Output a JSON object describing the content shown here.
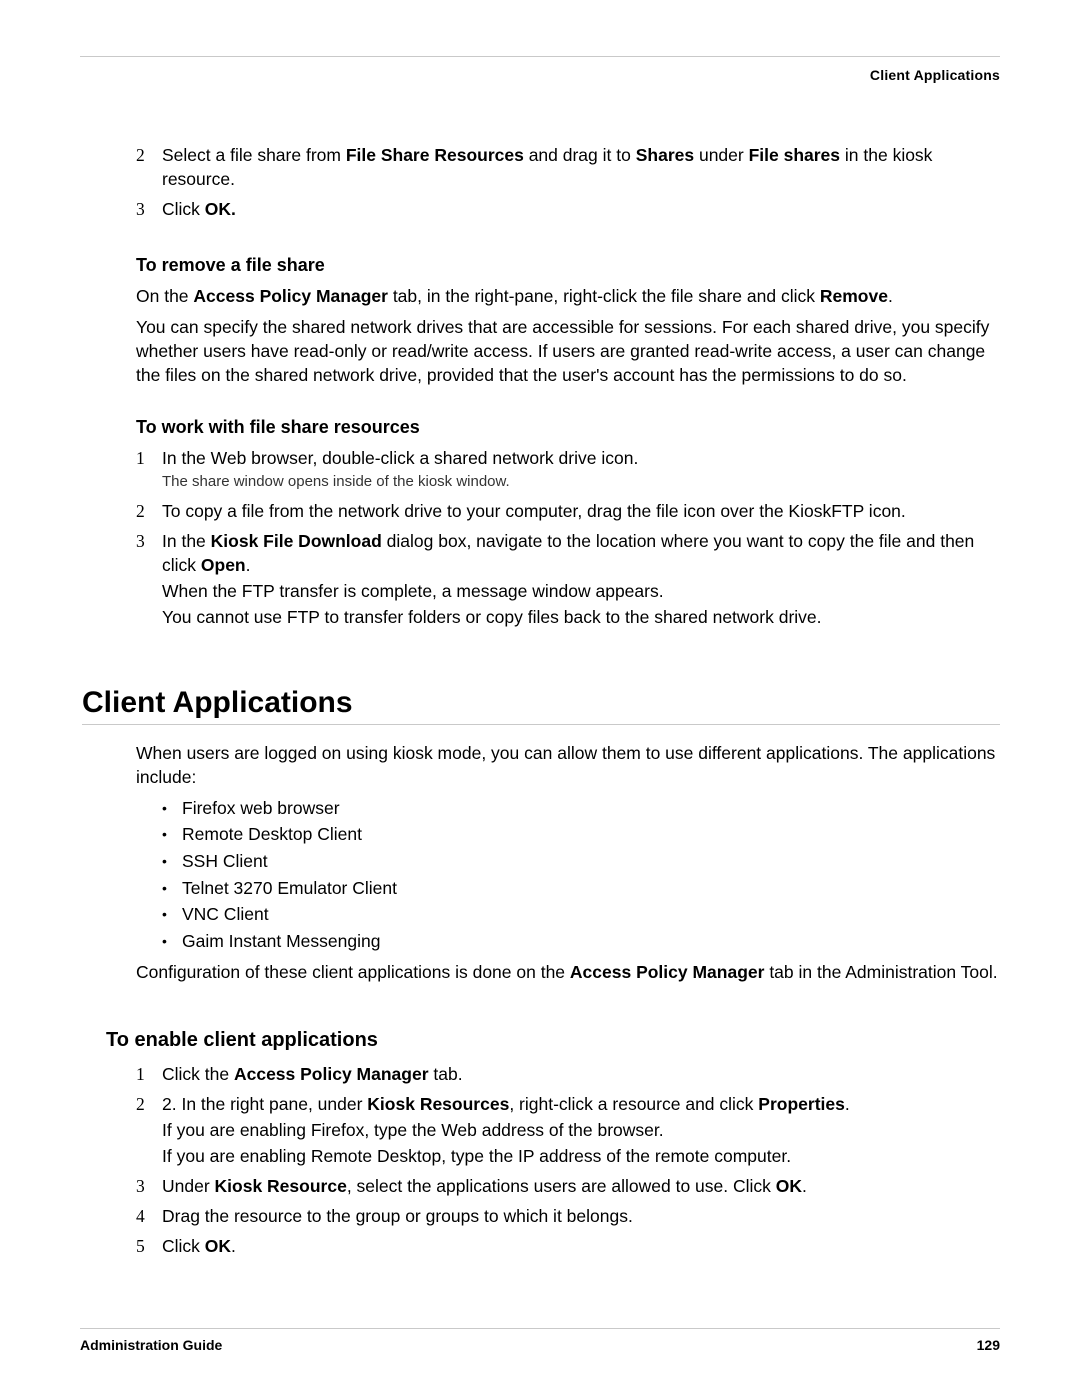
{
  "header": {
    "running": "Client Applications"
  },
  "footer": {
    "left": "Administration Guide",
    "right": "129"
  },
  "top_steps": [
    {
      "n": "2",
      "runs": [
        {
          "t": "Select a file share from "
        },
        {
          "t": "File Share Resources",
          "b": true
        },
        {
          "t": " and drag it to "
        },
        {
          "t": "Shares",
          "b": true
        },
        {
          "t": " under "
        },
        {
          "t": "File shares",
          "b": true
        },
        {
          "t": " in the kiosk resource."
        }
      ]
    },
    {
      "n": "3",
      "runs": [
        {
          "t": "Click "
        },
        {
          "t": "OK.",
          "b": true
        }
      ]
    }
  ],
  "remove_heading": "To remove a file share",
  "remove_p1_runs": [
    {
      "t": "On the "
    },
    {
      "t": "Access Policy Manager",
      "b": true
    },
    {
      "t": " tab, in the right-pane, right-click the file share and click "
    },
    {
      "t": "Remove",
      "b": true
    },
    {
      "t": "."
    }
  ],
  "remove_p2": "You can specify the shared network drives that are accessible for sessions. For each shared drive, you specify whether users have read-only or read/write access. If users are granted read-write access, a user can change the files on the shared network drive, provided that the user's account has the permissions to do so.",
  "work_heading": "To work with file share resources",
  "work_steps": [
    {
      "n": "1",
      "runs": [
        {
          "t": "In the Web browser, double-click a shared network drive icon."
        }
      ],
      "note": "The share window opens inside of the kiosk window."
    },
    {
      "n": "2",
      "runs": [
        {
          "t": "To copy a file from the network drive to your computer, drag the file icon over the KioskFTP icon."
        }
      ]
    },
    {
      "n": "3",
      "runs": [
        {
          "t": "In the "
        },
        {
          "t": "Kiosk File Download",
          "b": true
        },
        {
          "t": " dialog box, navigate to the location where you want to copy the file and then click "
        },
        {
          "t": "Open",
          "b": true
        },
        {
          "t": "."
        }
      ],
      "follow": [
        "When the FTP transfer is complete, a message window appears.",
        "You cannot use FTP to transfer folders or copy files back to the shared network drive."
      ]
    }
  ],
  "section_title": "Client Applications",
  "apps_intro": "When users are logged on using kiosk mode, you can allow them to use different applications. The applications include:",
  "apps_list": [
    "Firefox web browser",
    "Remote Desktop Client",
    "SSH Client",
    "Telnet 3270 Emulator Client",
    "VNC Client",
    "Gaim Instant Messenging"
  ],
  "apps_outro_runs": [
    {
      "t": "Configuration of these client applications is done on the "
    },
    {
      "t": "Access Policy Manager",
      "b": true
    },
    {
      "t": " tab in the Administration Tool."
    }
  ],
  "enable_heading": "To enable client applications",
  "enable_steps": [
    {
      "n": "1",
      "runs": [
        {
          "t": "Click the "
        },
        {
          "t": "Access Policy Manager",
          "b": true
        },
        {
          "t": " tab."
        }
      ]
    },
    {
      "n": "2",
      "runs": [
        {
          "t": "2. In the right pane, under "
        },
        {
          "t": "Kiosk Resources",
          "b": true
        },
        {
          "t": ", right-click a resource and click "
        },
        {
          "t": "Properties",
          "b": true
        },
        {
          "t": "."
        }
      ],
      "follow": [
        "If you are enabling Firefox, type the Web address of the browser.",
        "If you are enabling Remote Desktop, type the IP address of the remote computer."
      ]
    },
    {
      "n": "3",
      "runs": [
        {
          "t": "Under "
        },
        {
          "t": "Kiosk Resource",
          "b": true
        },
        {
          "t": ", select the applications users are allowed to use. Click "
        },
        {
          "t": "OK",
          "b": true
        },
        {
          "t": "."
        }
      ]
    },
    {
      "n": "4",
      "runs": [
        {
          "t": "Drag the resource to the group or groups to which it belongs."
        }
      ]
    },
    {
      "n": "5",
      "runs": [
        {
          "t": "Click "
        },
        {
          "t": "OK",
          "b": true
        },
        {
          "t": "."
        }
      ]
    }
  ]
}
